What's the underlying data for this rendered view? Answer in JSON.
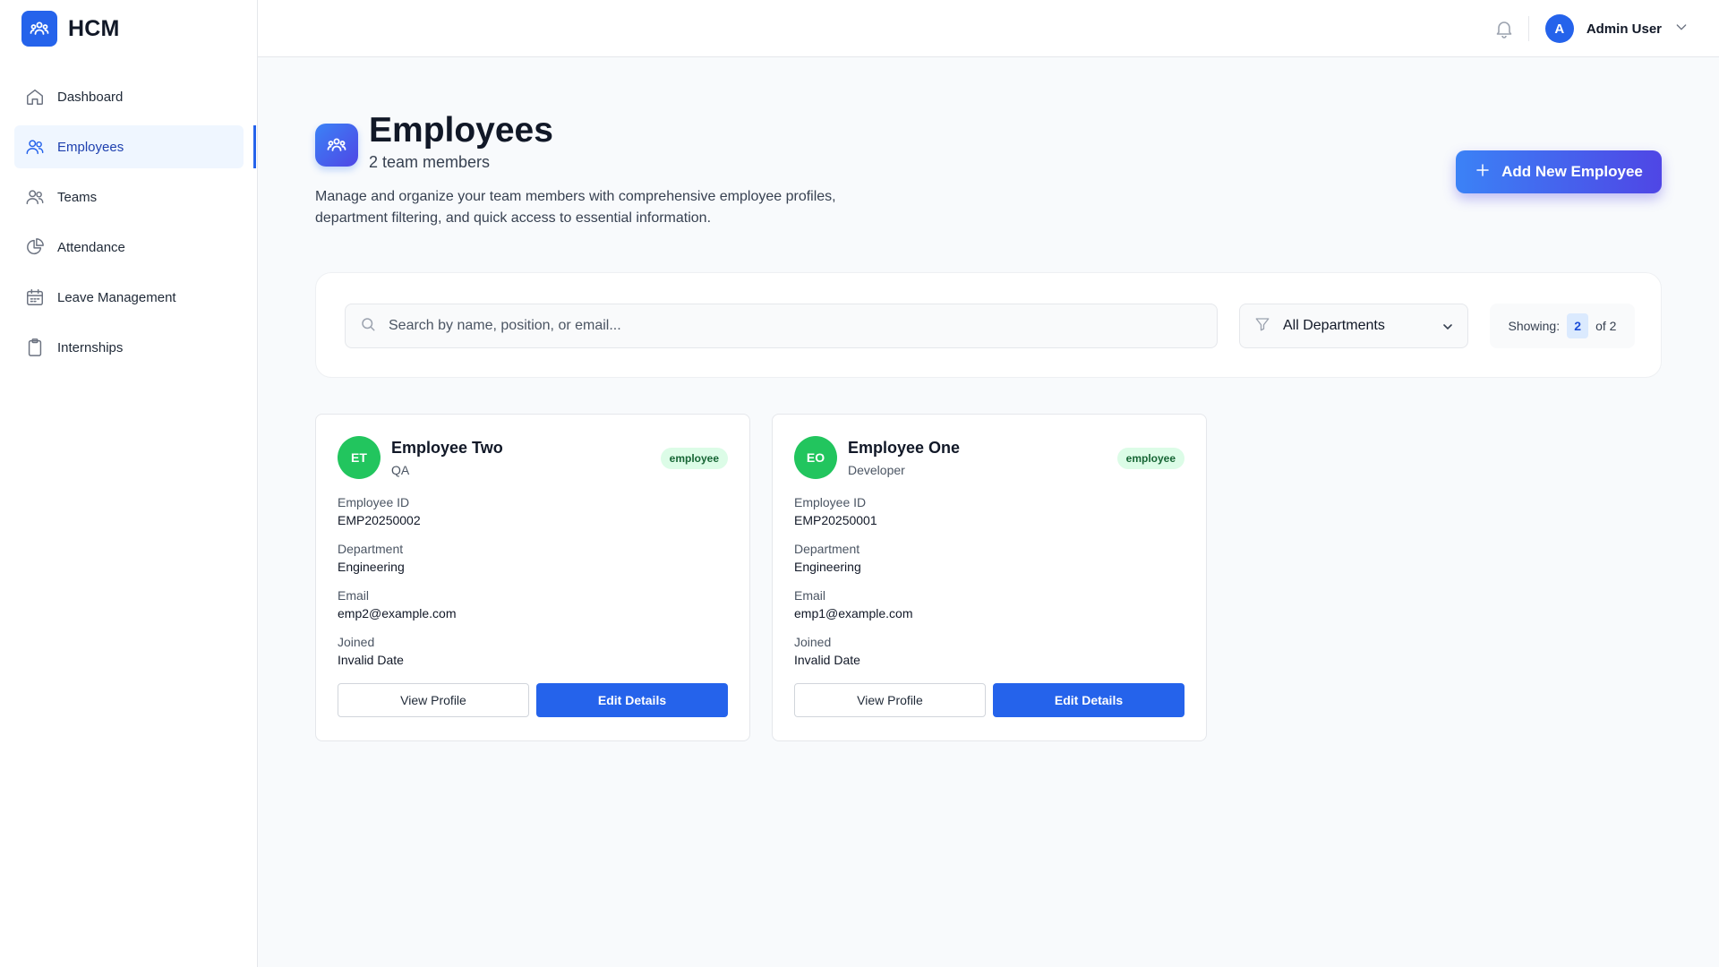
{
  "brand": {
    "name": "HCM",
    "icon": "users-group-icon"
  },
  "sidebar": {
    "items": [
      {
        "label": "Dashboard",
        "icon": "home-icon",
        "active": false
      },
      {
        "label": "Employees",
        "icon": "users-icon",
        "active": true
      },
      {
        "label": "Teams",
        "icon": "team-icon",
        "active": false
      },
      {
        "label": "Attendance",
        "icon": "pie-chart-icon",
        "active": false
      },
      {
        "label": "Leave Management",
        "icon": "calendar-icon",
        "active": false
      },
      {
        "label": "Internships",
        "icon": "clipboard-icon",
        "active": false
      }
    ]
  },
  "topbar": {
    "user": {
      "initial": "A",
      "name": "Admin User"
    }
  },
  "page": {
    "title": "Employees",
    "subtitle": "2 team members",
    "description": "Manage and organize your team members with comprehensive employee profiles, department filtering, and quick access to essential information.",
    "add_button": "Add New Employee"
  },
  "filters": {
    "search_placeholder": "Search by name, position, or email...",
    "department": "All Departments",
    "showing_label": "Showing:",
    "showing_count": "2",
    "showing_total": "of 2"
  },
  "employees": [
    {
      "initials": "ET",
      "name": "Employee Two",
      "position": "QA",
      "role": "employee",
      "fields": [
        {
          "label": "Employee ID",
          "value": "EMP20250002"
        },
        {
          "label": "Department",
          "value": "Engineering"
        },
        {
          "label": "Email",
          "value": "emp2@example.com"
        },
        {
          "label": "Joined",
          "value": "Invalid Date"
        }
      ],
      "view_label": "View Profile",
      "edit_label": "Edit Details"
    },
    {
      "initials": "EO",
      "name": "Employee One",
      "position": "Developer",
      "role": "employee",
      "fields": [
        {
          "label": "Employee ID",
          "value": "EMP20250001"
        },
        {
          "label": "Department",
          "value": "Engineering"
        },
        {
          "label": "Email",
          "value": "emp1@example.com"
        },
        {
          "label": "Joined",
          "value": "Invalid Date"
        }
      ],
      "view_label": "View Profile",
      "edit_label": "Edit Details"
    }
  ],
  "colors": {
    "primary": "#2563eb",
    "gradient_start": "#3b82f6",
    "gradient_end": "#4f46e5",
    "avatar_green": "#22c55e",
    "badge_bg": "#dcfce7"
  }
}
